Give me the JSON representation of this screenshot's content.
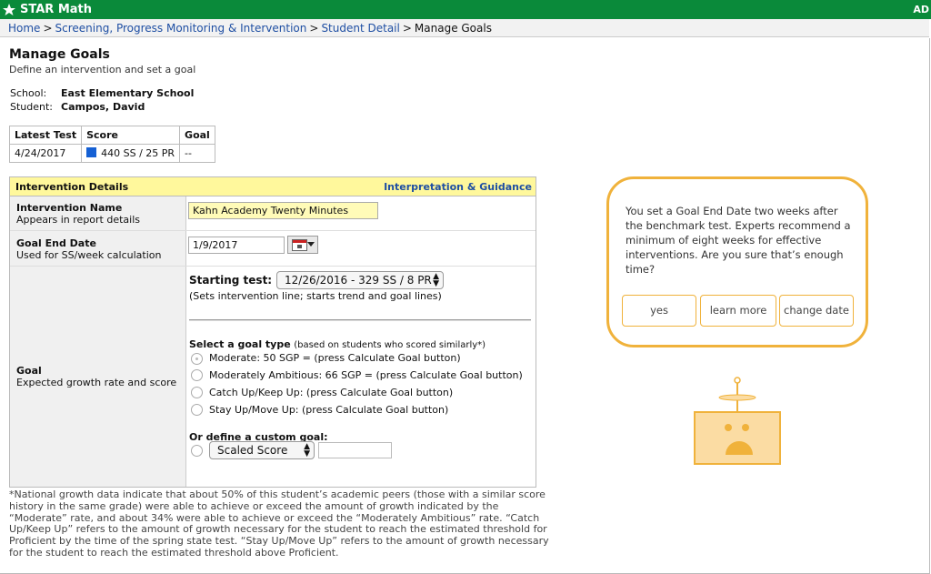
{
  "app": {
    "title": "STAR Math",
    "right_label": "AD"
  },
  "breadcrumb": {
    "items": [
      "Home",
      "Screening, Progress Monitoring & Intervention",
      "Student Detail"
    ],
    "current": "Manage Goals",
    "separator": ">"
  },
  "page": {
    "title": "Manage Goals",
    "subtitle": "Define an intervention and set a goal"
  },
  "student_info": {
    "school_label": "School:",
    "school": "East Elementary School",
    "student_label": "Student:",
    "student": "Campos, David"
  },
  "latest_test": {
    "headers": [
      "Latest Test",
      "Score",
      "Goal"
    ],
    "date": "4/24/2017",
    "score": "440 SS / 25 PR",
    "goal": "--",
    "score_color": "#1560d4"
  },
  "intervention": {
    "header": "Intervention Details",
    "guidance_link": "Interpretation & Guidance",
    "name_label": "Intervention Name",
    "name_desc": "Appears in report details",
    "name_value": "Kahn Academy Twenty Minutes",
    "end_label": "Goal End Date",
    "end_desc": "Used for SS/week calculation",
    "end_value": "1/9/2017",
    "goal_label": "Goal",
    "goal_desc": "Expected growth rate and score",
    "starting_label": "Starting test:",
    "starting_value": "12/26/2016 - 329 SS / 8 PR",
    "starting_note": "(Sets intervention line; starts trend and goal lines)",
    "goal_type_label": "Select a goal type",
    "goal_type_note": "(based on students who scored similarly*)",
    "options": [
      "Moderate: 50 SGP = (press Calculate Goal button)",
      "Moderately Ambitious: 66 SGP = (press Calculate Goal button)",
      "Catch Up/Keep Up: (press Calculate Goal button)",
      "Stay Up/Move Up: (press Calculate Goal button)"
    ],
    "selected_option": 0,
    "custom_label": "Or define a custom goal:",
    "custom_select": "Scaled Score",
    "custom_value": ""
  },
  "footnote": "*National growth data indicate that about 50% of this student’s academic peers (those with a similar score history in the same grade) were able to achieve or exceed the amount of growth indicated by the “Moderate” rate, and about 34% were able to achieve or exceed the “Moderately Ambitious” rate. “Catch Up/Keep Up” refers to the amount of growth necessary for the student to reach the estimated threshold for Proficient by the time of the spring state test. “Stay Up/Move Up” refers to the amount of growth necessary for the student to reach the estimated threshold above Proficient.",
  "assistant": {
    "message": "You set a Goal End Date two weeks after the benchmark test. Experts recommend a minimum of eight weeks for effective interventions. Are you sure that’s enough time?",
    "buttons": [
      "yes",
      "learn more",
      "change date"
    ],
    "accent": "#f0b23b",
    "robot_face": "#fbdca3"
  }
}
